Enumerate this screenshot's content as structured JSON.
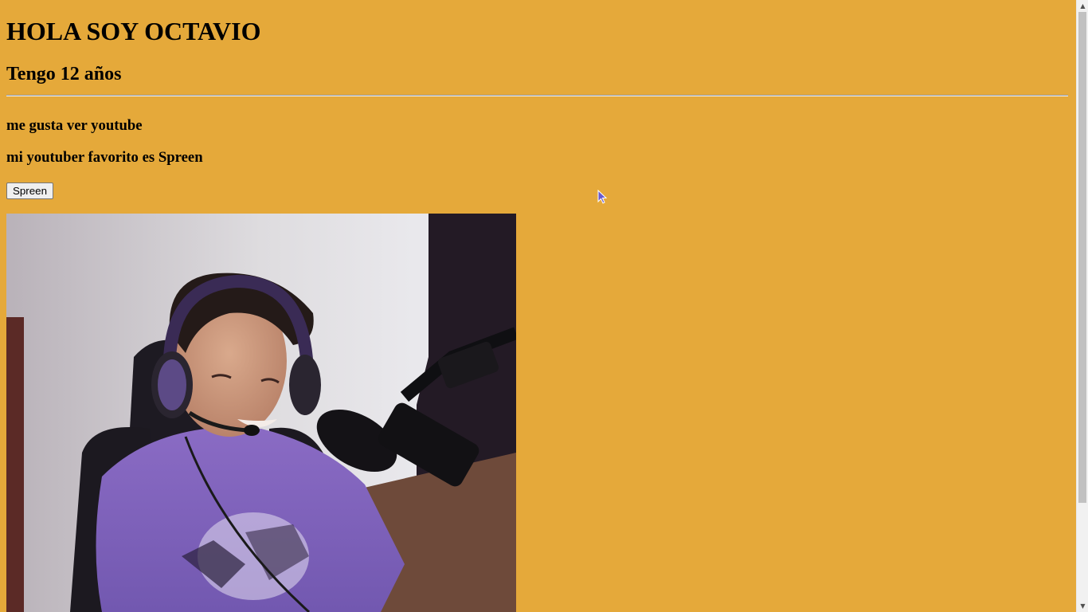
{
  "page": {
    "background_color": "#e5a93a",
    "heading": "HOLA SOY OCTAVIO",
    "subheading": "Tengo 12 años",
    "line1": "me gusta ver youtube",
    "line2": "mi youtuber favorito es Spreen",
    "button_label": "Spreen"
  },
  "photo": {
    "subject": "person with headset and microphone"
  },
  "icons": {
    "cursor": "mouse-pointer-icon",
    "scroll_up": "scroll-up-arrow-icon",
    "scroll_down": "scroll-down-arrow-icon"
  },
  "scroll": {
    "up_glyph": "▲",
    "down_glyph": "▼"
  }
}
